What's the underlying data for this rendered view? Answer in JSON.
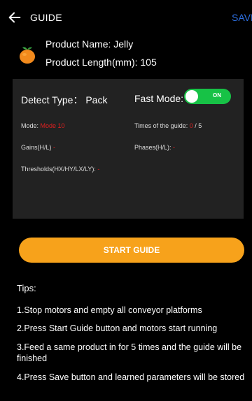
{
  "header": {
    "title": "GUIDE",
    "save_label": "SAVE"
  },
  "product": {
    "icon": "orange-fruit-icon",
    "name_line": "Product Name:  Jelly",
    "length_line": "Product Length(mm):  105"
  },
  "panel": {
    "detect_type_line": "Detect Type：  Pack",
    "fast_mode_label": "Fast Mode:",
    "fast_mode_state": "ON",
    "mode_label": "Mode:",
    "mode_value": "Mode 10",
    "times_label": "Times of the guide:",
    "times_current": "0",
    "times_sep": " / ",
    "times_total": "5",
    "gains_label": "Gains(H/L)",
    "gains_value": "-",
    "phases_label": "Phases(H/L):",
    "phases_value": "-",
    "thresholds_label": "Thresholds(HX/HY/LX/LY):",
    "thresholds_value": "-"
  },
  "start_button": {
    "label": "START GUIDE"
  },
  "tips": {
    "title": "Tips:",
    "items": [
      "1.Stop motors and empty all conveyor platforms",
      "2.Press Start Guide button and motors start running",
      "3.Feed a same product in for 5 times and the guide will be finished",
      "4.Press Save button and learned parameters will be stored"
    ]
  },
  "colors": {
    "background": "#000000",
    "panel": "#222222",
    "accent_orange": "#f7a21b",
    "toggle_on": "#17c246",
    "save_blue": "#2d6fe0",
    "value_red": "#e02020"
  }
}
